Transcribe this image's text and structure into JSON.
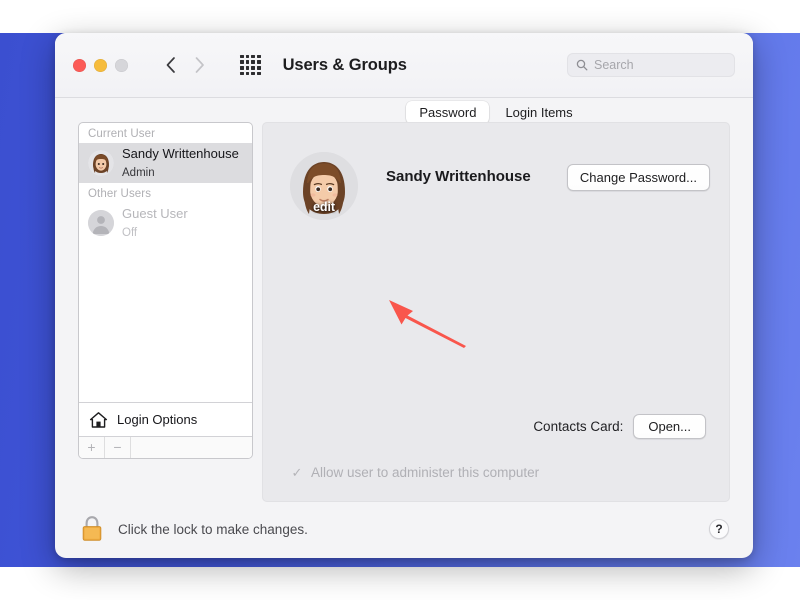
{
  "window": {
    "title": "Users & Groups",
    "traffic_lights": [
      "close-red",
      "minimize-yellow",
      "zoom-gray-disabled"
    ],
    "nav": {
      "back_icon": "chevron-left-icon",
      "forward_icon": "chevron-right-icon",
      "grid_icon": "show-all-grid-icon"
    },
    "search": {
      "placeholder": "Search",
      "value": "",
      "icon": "search-icon"
    }
  },
  "sidebar": {
    "groups": [
      {
        "header": "Current User",
        "users": [
          {
            "name": "Sandy Writtenhouse",
            "role": "Admin",
            "selected": true,
            "avatar": "memoji-avatar"
          }
        ]
      },
      {
        "header": "Other Users",
        "users": [
          {
            "name": "Guest User",
            "role": "Off",
            "selected": false,
            "avatar": "guest-silhouette-avatar"
          }
        ]
      }
    ],
    "login_options": {
      "label": "Login Options",
      "icon": "home-icon"
    },
    "add_button": "+",
    "remove_button": "−"
  },
  "content": {
    "tabs": [
      {
        "label": "Password",
        "active": true
      },
      {
        "label": "Login Items",
        "active": false
      }
    ],
    "profile": {
      "avatar": "memoji-avatar",
      "edit_badge": "edit",
      "display_name": "Sandy Writtenhouse",
      "change_password_label": "Change Password..."
    },
    "contacts": {
      "label": "Contacts Card:",
      "open_label": "Open..."
    },
    "admin_checkbox": {
      "label": "Allow user to administer this computer",
      "checked": true,
      "enabled": false,
      "check_glyph": "✓"
    }
  },
  "footer": {
    "lock_icon": "closed-padlock-icon",
    "lock_text": "Click the lock to make changes.",
    "help_label": "?"
  },
  "annotation": {
    "arrow_icon": "red-arrow-pointing-upper-left",
    "color": "#f9564c"
  },
  "colors": {
    "desktop_blue": "#4257db",
    "window_bg": "#f4f4f6",
    "content_panel": "#e9e9ec",
    "selected_row": "#dcdcdf",
    "lock_gold": "#f0ab3e",
    "annotation_red": "#f9564c"
  }
}
